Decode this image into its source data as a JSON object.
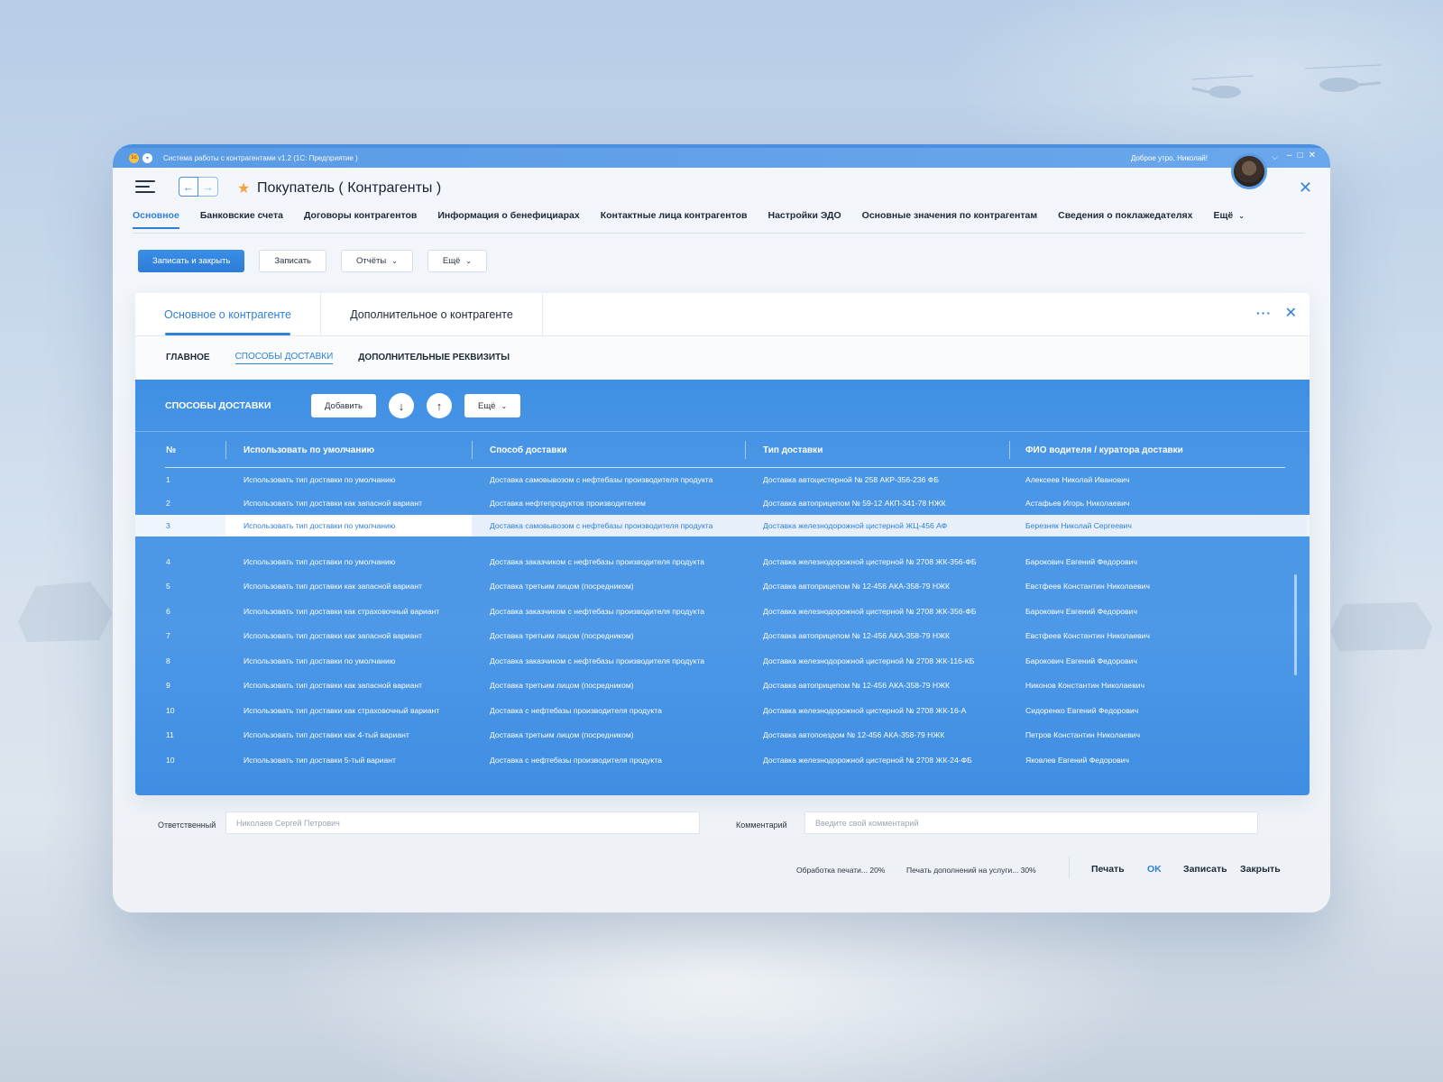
{
  "window": {
    "title": "Система работы с контрагентами v1.2 (1С: Предприятие )",
    "greeting": "Доброе утро, Николай!"
  },
  "header": {
    "page_title": "Покупатель ( Контрагенты )"
  },
  "tabs": [
    {
      "label": "Основное",
      "active": true
    },
    {
      "label": "Банковские счета"
    },
    {
      "label": "Договоры контрагентов"
    },
    {
      "label": "Информация о бенефициарах"
    },
    {
      "label": "Контактные лица контрагентов"
    },
    {
      "label": "Настройки ЭДО"
    },
    {
      "label": "Основные значения по контрагентам"
    },
    {
      "label": "Сведения о поклажедателях"
    },
    {
      "label": "Ещё"
    }
  ],
  "toolbar": {
    "save_close": "Записать и закрыть",
    "save": "Записать",
    "reports": "Отчёты",
    "more": "Ещё"
  },
  "panel": {
    "tabs": [
      "Основное о контрагенте",
      "Дополнительное о контрагенте"
    ],
    "subtabs": [
      "ГЛАВНОЕ",
      "СПОСОБЫ ДОСТАВКИ",
      "ДОПОЛНИТЕЛЬНЫЕ РЕКВИЗИТЫ"
    ]
  },
  "grid": {
    "title": "СПОСОБЫ ДОСТАВКИ",
    "add_label": "Добавить",
    "more_label": "Ещё",
    "columns": [
      "№",
      "Использовать по умолчанию",
      "Способ доставки",
      "Тип доставки",
      "ФИО водителя / куратора доставки"
    ],
    "rows": [
      {
        "n": "1",
        "use": "Использовать тип доставки по умолчанию",
        "method": "Доставка самовывозом с нефтебазы производителя продукта",
        "type": "Доставка автоцистерной № 258 АКР-356-236 ФБ",
        "driver": "Алексеев Николай Иванович"
      },
      {
        "n": "2",
        "use": "Использовать тип доставки как запасной вариант",
        "method": "Доставка нефтепродуктов производителем",
        "type": "Доставка автоприцепом № 59-12 АКП-341-78 НЖК",
        "driver": "Астафьев Игорь Николаевич"
      },
      {
        "n": "3",
        "use": "Использовать тип доставки по умолчанию",
        "method": "Доставка самовывозом с нефтебазы производителя продукта",
        "type": "Доставка железнодорожной цистерной ЖЦ-456 АФ",
        "driver": "Березняк Николай Сергеевич"
      },
      {
        "n": "4",
        "use": "Использовать тип доставки по умолчанию",
        "method": "Доставка заказчиком с нефтебазы производителя продукта",
        "type": "Доставка железнодорожной цистерной № 2708 ЖК-356-ФБ",
        "driver": "Барокович Евгений Федорович"
      },
      {
        "n": "5",
        "use": "Использовать тип доставки как запасной вариант",
        "method": "Доставка третьим лицом (посредником)",
        "type": "Доставка автоприцепом № 12-456 АКА-358-79 НЖК",
        "driver": "Евстфеев Константин Николаевич"
      },
      {
        "n": "6",
        "use": "Использовать тип доставки как страховочный вариант",
        "method": "Доставка заказчиком с нефтебазы производителя продукта",
        "type": "Доставка железнодорожной цистерной № 2708 ЖК-356-ФБ",
        "driver": "Барокович Евгений Федорович"
      },
      {
        "n": "7",
        "use": "Использовать тип доставки как запасной вариант",
        "method": "Доставка третьим лицом (посредником)",
        "type": "Доставка автоприцепом № 12-456 АКА-358-79 НЖК",
        "driver": "Евстфеев Константин Николаевич"
      },
      {
        "n": "8",
        "use": "Использовать тип доставки по умолчанию",
        "method": "Доставка заказчиком с нефтебазы производителя продукта",
        "type": "Доставка железнодорожной цистерной № 2708 ЖК-116-КБ",
        "driver": "Барокович Евгений Федорович"
      },
      {
        "n": "9",
        "use": "Использовать тип доставки как запасной вариант",
        "method": "Доставка третьим лицом (посредником)",
        "type": "Доставка автоприцепом № 12-456 АКА-358-79 НЖК",
        "driver": "Никонов Константин Николаевич"
      },
      {
        "n": "10",
        "use": "Использовать тип доставки как страховочный вариант",
        "method": "Доставка  с нефтебазы производителя продукта",
        "type": "Доставка железнодорожной цистерной № 2708 ЖК-16-А",
        "driver": "Сидоренко Евгений Федорович"
      },
      {
        "n": "11",
        "use": "Использовать тип доставки как 4-тый вариант",
        "method": "Доставка третьим лицом (посредником)",
        "type": "Доставка автопоездом № 12-456 АКА-358-79 НЖК",
        "driver": "Петров Константин Николаевич"
      },
      {
        "n": "10",
        "use": "Использовать тип доставки 5-тый вариант",
        "method": "Доставка  с нефтебазы производителя продукта",
        "type": "Доставка железнодорожной цистерной № 2708 ЖК-24-ФБ",
        "driver": "Яковлев Евгений Федорович"
      }
    ],
    "selected_row": 2
  },
  "bottom": {
    "responsible_label": "Ответственный",
    "responsible_value": "Николаев Сергей Петрович",
    "comment_label": "Комментарий",
    "comment_placeholder": "Введите свой комментарий"
  },
  "footer": {
    "progress1": "Обработка печати... 20%",
    "progress2": "Печать дополнений на услуги... 30%",
    "print": "Печать",
    "ok": "OK",
    "save": "Записать",
    "close": "Закрыть"
  },
  "colors": {
    "accent": "#2f7fd6",
    "grid_bg": "#4a96e6",
    "star": "#f2a33a"
  }
}
